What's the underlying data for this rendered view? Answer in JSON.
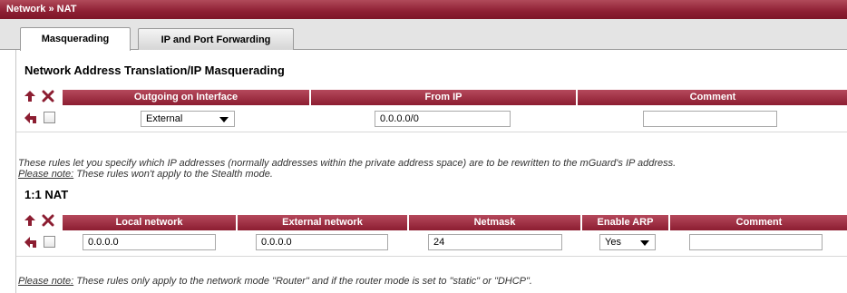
{
  "titlebar": {
    "breadcrumb": "Network » NAT"
  },
  "tabs": [
    {
      "label": "Masquerading",
      "active": true
    },
    {
      "label": "IP and Port Forwarding",
      "active": false
    }
  ],
  "masquerading": {
    "title": "Network Address Translation/IP Masquerading",
    "columns": [
      "Outgoing on Interface",
      "From IP",
      "Comment"
    ],
    "rows": [
      {
        "interface": "External",
        "from_ip": "0.0.0.0/0",
        "comment": ""
      }
    ],
    "note_line1": "These rules let you specify which IP addresses (normally addresses within the private address space) are to be rewritten to the mGuard's IP address.",
    "note_prefix": "Please note:",
    "note_line2": " These rules won't apply to the Stealth mode."
  },
  "one_to_one": {
    "title": "1:1 NAT",
    "columns": [
      "Local network",
      "External network",
      "Netmask",
      "Enable ARP",
      "Comment"
    ],
    "rows": [
      {
        "local": "0.0.0.0",
        "external": "0.0.0.0",
        "netmask": "24",
        "arp": "Yes",
        "comment": ""
      }
    ],
    "note_prefix": "Please note:",
    "note_text": " These rules only apply to the network mode \"Router\" and if the router mode is set to \"static\" or \"DHCP\"."
  },
  "icons": {
    "insert": "insert-row-icon",
    "delete": "delete-row-icon",
    "row_insert": "insert-after-row-icon"
  },
  "colors": {
    "header": "#8c1d31",
    "titlebar": "#8e1f33",
    "tabstrip": "#e4e4e4"
  }
}
